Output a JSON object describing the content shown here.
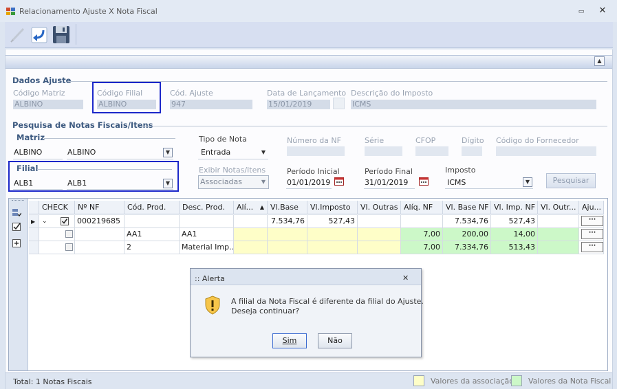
{
  "window": {
    "title": "Relacionamento Ajuste X Nota Fiscal",
    "minimize_glyph": "▭",
    "close_glyph": "✕"
  },
  "toolbar": {
    "items": [
      "edit-icon",
      "undo-arrow-icon",
      "save-disk-icon"
    ]
  },
  "dados_ajuste": {
    "title": "Dados Ajuste",
    "codigo_matriz_label": "Código Matriz",
    "codigo_matriz_value": "ALBINO",
    "codigo_filial_label": "Código Filial",
    "codigo_filial_value": "ALBINO",
    "cod_ajuste_label": "Cód. Ajuste",
    "cod_ajuste_value": "947",
    "data_lancamento_label": "Data de Lançamento",
    "data_lancamento_value": "15/01/2019",
    "descricao_imposto_label": "Descrição do Imposto",
    "descricao_imposto_value": "ICMS"
  },
  "pesquisa": {
    "title": "Pesquisa de Notas Fiscais/Itens",
    "matriz_label": "Matriz",
    "matriz_code": "ALBINO",
    "matriz_name": "ALBINO",
    "filial_label": "Filial",
    "filial_code": "ALB1",
    "filial_name": "ALB1",
    "tipo_nota_label": "Tipo de Nota",
    "tipo_nota_value": "Entrada",
    "exibir_label": "Exibir Notas/Itens",
    "exibir_value": "Associadas",
    "numero_nf_label": "Número da NF",
    "serie_label": "Série",
    "cfop_label": "CFOP",
    "digito_label": "Dígito",
    "codigo_fornecedor_label": "Código do Fornecedor",
    "periodo_inicial_label": "Período Inicial",
    "periodo_inicial_value": "01/01/2019",
    "periodo_final_label": "Período Final",
    "periodo_final_value": "31/01/2019",
    "imposto_label": "Imposto",
    "imposto_value": "ICMS",
    "pesquisar_label": "Pesquisar"
  },
  "grid": {
    "columns": [
      "CHECK",
      "Nº NF",
      "Cód. Prod.",
      "Desc. Prod.",
      "Alí...",
      "Vl.Base",
      "Vl.Imposto",
      "Vl. Outras",
      "Alíq. NF",
      "Vl. Base NF",
      "Vl. Imp. NF",
      "Vl. Outr...",
      "Aju..."
    ],
    "sort_glyph": "▲",
    "ellipsis": "···",
    "rows": [
      {
        "nf": "000219685",
        "cod": "",
        "desc": "",
        "aliq": "",
        "vl_base": "7.534,76",
        "vl_imposto": "527,43",
        "vl_outras": "",
        "aliq_nf": "",
        "vl_base_nf": "7.534,76",
        "vl_imp_nf": "527,43",
        "vl_outr": ""
      },
      {
        "nf": "",
        "cod": "AA1",
        "desc": "AA1",
        "aliq": "",
        "vl_base": "",
        "vl_imposto": "",
        "vl_outras": "",
        "aliq_nf": "7,00",
        "vl_base_nf": "200,00",
        "vl_imp_nf": "14,00",
        "vl_outr": ""
      },
      {
        "nf": "",
        "cod": "2",
        "desc": "Material Imp...",
        "aliq": "",
        "vl_base": "",
        "vl_imposto": "",
        "vl_outras": "",
        "aliq_nf": "7,00",
        "vl_base_nf": "7.334,76",
        "vl_imp_nf": "513,43",
        "vl_outr": ""
      }
    ]
  },
  "dialog": {
    "title": ":: Alerta",
    "message_line1": "A filial da Nota Fiscal é diferente da filial do Ajuste.",
    "message_line2": "Deseja continuar?",
    "yes_label": "Sim",
    "no_label": "Não",
    "close_glyph": "✕"
  },
  "status": {
    "total_text": "Total: 1 Notas Fiscais",
    "legend_assoc": "Valores da associação",
    "legend_nf": "Valores da Nota Fiscal"
  },
  "colors": {
    "association": "#fefec8",
    "nota_fiscal": "#ccf8c8",
    "highlight_border": "#1b27c9"
  }
}
